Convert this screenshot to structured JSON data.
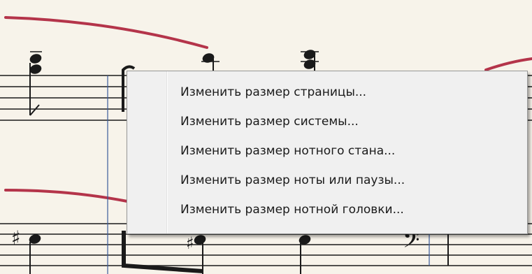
{
  "context_menu": {
    "items": [
      {
        "label": "Изменить размер страницы..."
      },
      {
        "label": "Изменить размер системы..."
      },
      {
        "label": "Изменить размер нотного стана..."
      },
      {
        "label": "Изменить размер ноты или паузы..."
      },
      {
        "label": "Изменить размер нотной головки..."
      }
    ]
  },
  "colors": {
    "paper": "#f7f3ea",
    "staff_line": "#1a1a1a",
    "slur": "#b4344a",
    "selection_line": "#3a5b9a",
    "menu_background": "#f0f0f0",
    "menu_border": "#979797"
  }
}
